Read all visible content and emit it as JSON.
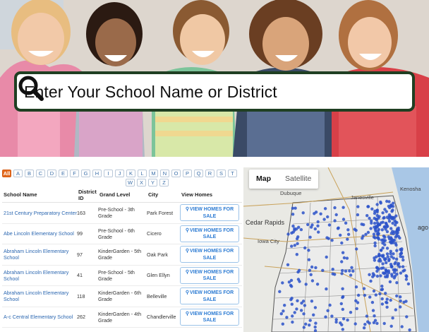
{
  "hero": {
    "search_placeholder": "Enter Your School Name or District",
    "search_icon": "magnifier-icon"
  },
  "alphabet": {
    "all_label": "All",
    "row1": [
      "A",
      "B",
      "C",
      "D",
      "E",
      "F",
      "G",
      "H",
      "I",
      "J",
      "K",
      "L",
      "M",
      "N",
      "O",
      "P",
      "Q",
      "R",
      "S",
      "T"
    ],
    "row2": [
      "W",
      "X",
      "Y",
      "Z"
    ]
  },
  "table": {
    "headers": {
      "school_name": "School Name",
      "district_id": "District ID",
      "grand_level": "Grand Level",
      "city": "City",
      "view_homes": "View Homes"
    },
    "button_label": "VIEW HOMES FOR SALE",
    "rows": [
      {
        "name": "21st Century Preparatory Center",
        "district": "163",
        "grade": "Pre-School - 3th Grade",
        "city": "Park Forest"
      },
      {
        "name": "Abe Lincoln Elementary School",
        "district": "99",
        "grade": "Pre-School - 6th Grade",
        "city": "Cicero"
      },
      {
        "name": "Abraham Lincoln Elementary School",
        "district": "97",
        "grade": "KinderGarden - 5th Grade",
        "city": "Oak Park"
      },
      {
        "name": "Abraham Lincoln Elementary School",
        "district": "41",
        "grade": "Pre-School - 5th Grade",
        "city": "Glen Ellyn"
      },
      {
        "name": "Abraham Lincoln Elementary School",
        "district": "118",
        "grade": "KinderGarden - 6th Grade",
        "city": "Belleville"
      },
      {
        "name": "A-c Central Elementary School",
        "district": "262",
        "grade": "KinderGarden - 4th Grade",
        "city": "Chandlerville"
      }
    ]
  },
  "map": {
    "tabs": [
      "Map",
      "Satellite"
    ],
    "active_tab": "Map",
    "places": {
      "janesville": "Janesville",
      "kenosha": "Kenosha",
      "dubuque": "Dubuque",
      "cedar_rapids": "Cedar Rapids",
      "iowa_city": "Iowa City",
      "chicago": "ago"
    },
    "highway_shields": [
      "90",
      "43",
      "94",
      "90",
      "380",
      "80",
      "80",
      "74",
      "55",
      "57"
    ],
    "marker_color": "#2b52c9"
  }
}
